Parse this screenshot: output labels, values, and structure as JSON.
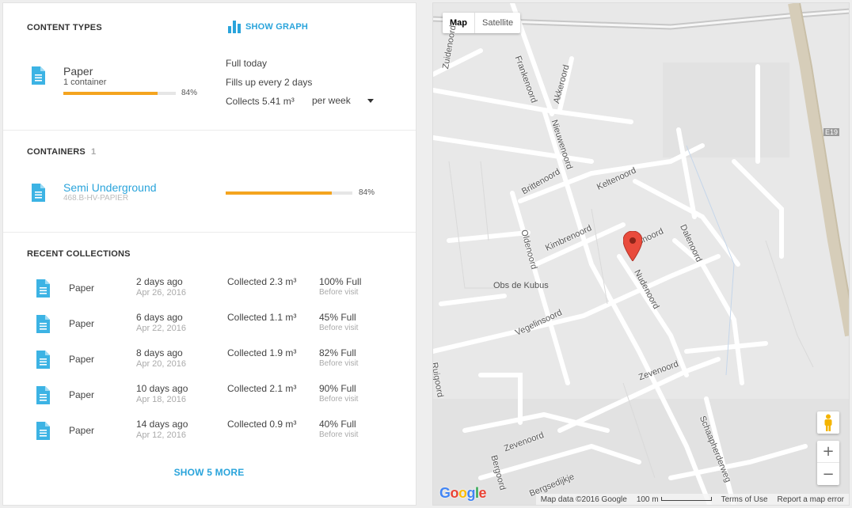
{
  "content_types": {
    "title": "CONTENT TYPES",
    "show_graph": "SHOW GRAPH",
    "item": {
      "name": "Paper",
      "sub": "1 container",
      "fill_percent": 84,
      "pct_label": "84%"
    },
    "status": "Full today",
    "frequency": "Fills up every 2 days",
    "collects": "Collects 5.41 m³",
    "period": "per week",
    "icon": "document-icon",
    "accent": "#2aa4db",
    "bar_color": "#f4a41f"
  },
  "containers": {
    "title": "CONTAINERS",
    "count": "1",
    "item": {
      "name": "Semi Underground",
      "id": "468.B-HV-PAPIER",
      "fill_percent": 84,
      "pct_label": "84%"
    }
  },
  "recent": {
    "title": "RECENT COLLECTIONS",
    "rows": [
      {
        "type": "Paper",
        "when": "2 days ago",
        "date": "Apr 26, 2016",
        "collected": "Collected 2.3 m³",
        "full": "100% Full",
        "before": "Before visit"
      },
      {
        "type": "Paper",
        "when": "6 days ago",
        "date": "Apr 22, 2016",
        "collected": "Collected 1.1 m³",
        "full": "45% Full",
        "before": "Before visit"
      },
      {
        "type": "Paper",
        "when": "8 days ago",
        "date": "Apr 20, 2016",
        "collected": "Collected 1.9 m³",
        "full": "82% Full",
        "before": "Before visit"
      },
      {
        "type": "Paper",
        "when": "10 days ago",
        "date": "Apr 18, 2016",
        "collected": "Collected 2.1 m³",
        "full": "90% Full",
        "before": "Before visit"
      },
      {
        "type": "Paper",
        "when": "14 days ago",
        "date": "Apr 12, 2016",
        "collected": "Collected 0.9 m³",
        "full": "40% Full",
        "before": "Before visit"
      }
    ],
    "show_more": "SHOW 5 MORE"
  },
  "map": {
    "type_map": "Map",
    "type_satellite": "Satellite",
    "streets": {
      "frankenoord": "Frankenoord",
      "akkeroord": "Akkeroord",
      "nieuwenoord": "Nieuwenoord",
      "brittenoord": "Brittenoord",
      "keltenoord": "Keltenoord",
      "kimbrenoord": "Kimbrenoord",
      "oldenoord": "Oldenoord",
      "bonoord": "Bonoord",
      "dalenoord": "Dalenoord",
      "nudenoord": "Nudenoord",
      "vegelinsoord": "Vegelinsoord",
      "ruigoord": "Ruigoord",
      "zevenoord": "Zevenoord",
      "zevenoord2": "Zevenoord",
      "bergoord": "Bergoord",
      "schaapherderweg": "Schaapherderweg",
      "bergsedijkje": "Bergsedijkje",
      "zuidenoord": "Zuidenoord",
      "highway": "E19"
    },
    "poi": "Obs de Kubus",
    "google": "Google",
    "footer": {
      "map_data": "Map data ©2016 Google",
      "scale": "100 m",
      "terms": "Terms of Use",
      "report": "Report a map error"
    }
  }
}
